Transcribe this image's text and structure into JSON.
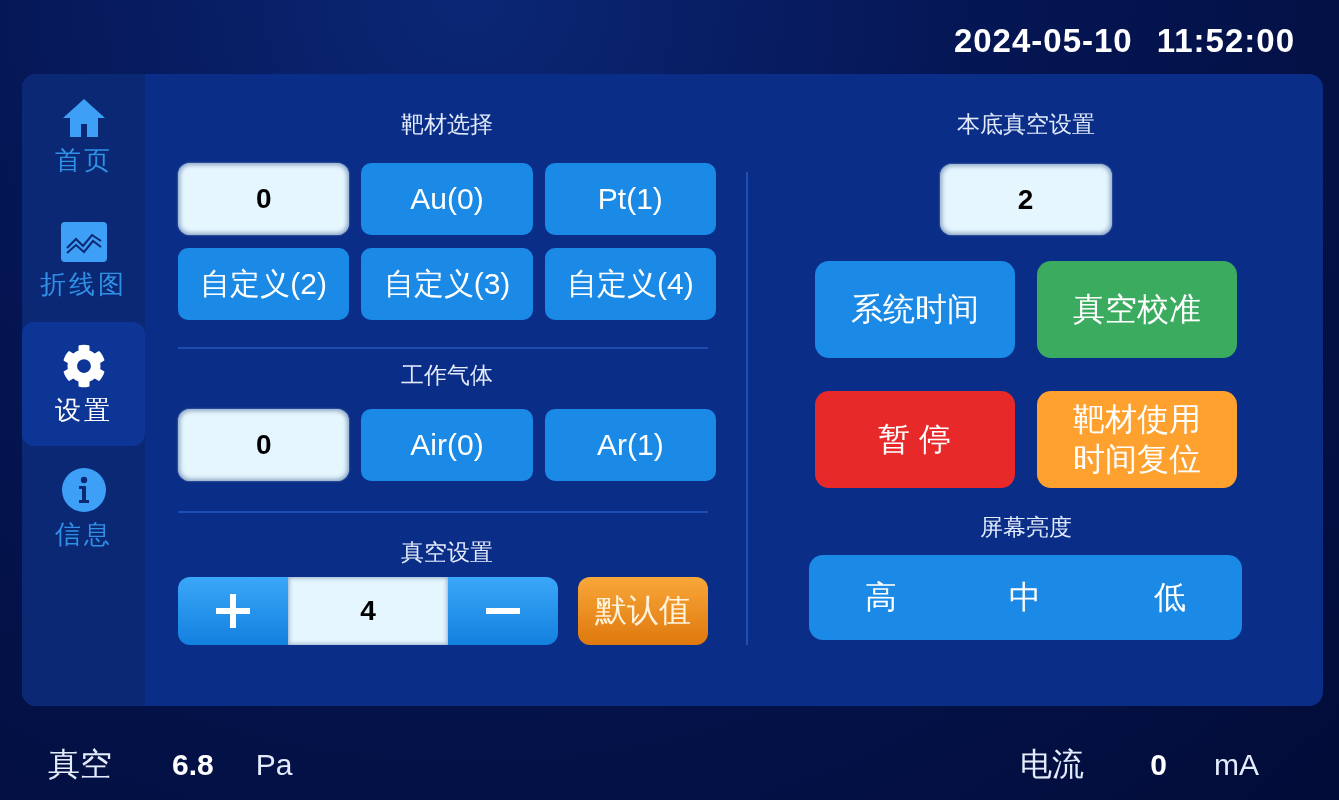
{
  "datetime": {
    "date": "2024-05-10",
    "time": "11:52:00"
  },
  "sidebar": {
    "items": [
      {
        "kind": "home",
        "label": "首页",
        "selected": false
      },
      {
        "kind": "chart",
        "label": "折线图",
        "selected": false
      },
      {
        "kind": "settings",
        "label": "设置",
        "selected": true
      },
      {
        "kind": "info",
        "label": "信息",
        "selected": false
      }
    ]
  },
  "target_material": {
    "title": "靶材选择",
    "value": "0",
    "options": [
      "Au(0)",
      "Pt(1)",
      "自定义(2)",
      "自定义(3)",
      "自定义(4)"
    ]
  },
  "working_gas": {
    "title": "工作气体",
    "value": "0",
    "options": [
      "Air(0)",
      "Ar(1)"
    ]
  },
  "vacuum_setting": {
    "title": "真空设置",
    "value": "4",
    "default_button": "默认值"
  },
  "base_vacuum": {
    "title": "本底真空设置",
    "value": "2"
  },
  "action_rows": [
    {
      "buttons": [
        {
          "label": "系统时间",
          "color": "#1a8ae6"
        },
        {
          "label": "真空校准",
          "color": "#3aab5f"
        }
      ]
    },
    {
      "buttons": [
        {
          "label": "暂 停",
          "color": "#e8292a"
        },
        {
          "label": "靶材使用时间复位",
          "color": "#ffa12f"
        }
      ]
    }
  ],
  "brightness": {
    "title": "屏幕亮度",
    "options": [
      {
        "label": "高",
        "selected": false
      },
      {
        "label": "中",
        "selected": false
      },
      {
        "label": "低",
        "selected": false
      }
    ]
  },
  "status_bar": {
    "vacuum": {
      "label": "真空",
      "value": "6.8",
      "unit": "Pa"
    },
    "current": {
      "label": "电流",
      "value": "0",
      "unit": "mA"
    }
  }
}
